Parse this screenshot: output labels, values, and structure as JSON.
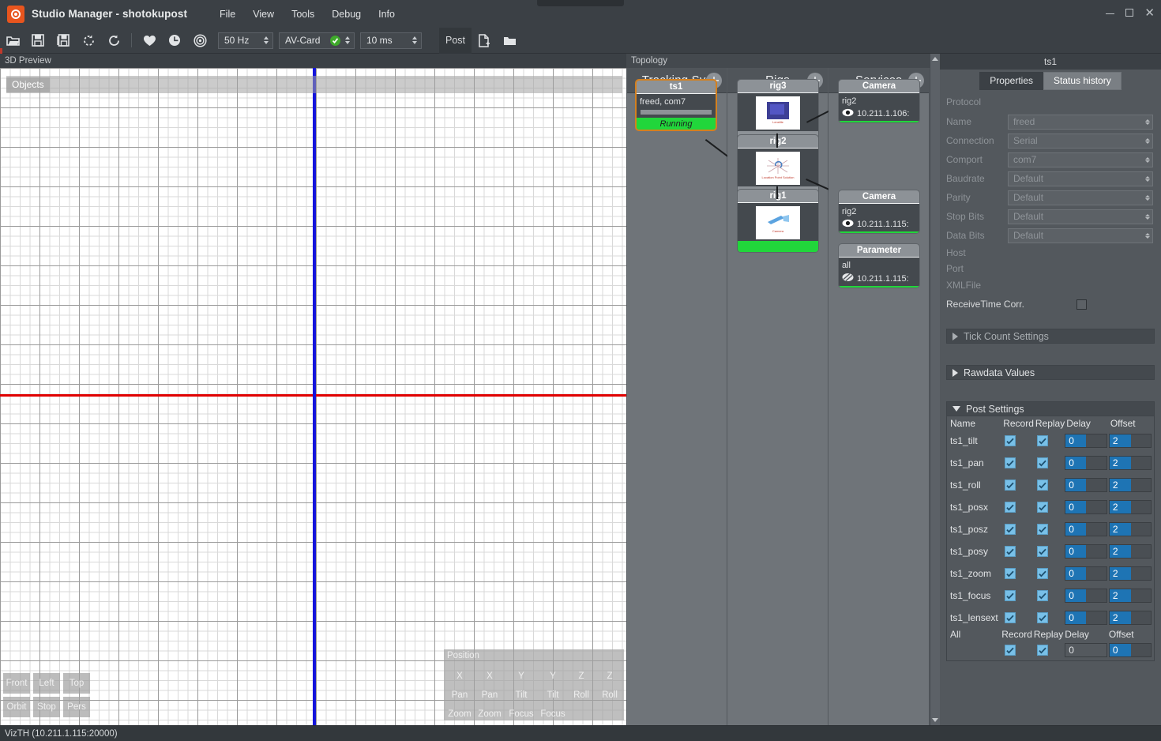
{
  "window": {
    "title": "Studio Manager - shotokupost",
    "logo_icon": "studio-manager-logo",
    "minimize_label": "minimize",
    "maximize_label": "maximize",
    "close_label": "✕"
  },
  "menubar": {
    "items": [
      "File",
      "View",
      "Tools",
      "Debug",
      "Info"
    ]
  },
  "toolbar": {
    "icons": [
      {
        "name": "open-folder-icon"
      },
      {
        "name": "save-icon"
      },
      {
        "name": "save-as-icon"
      },
      {
        "name": "reload-dashed-icon"
      },
      {
        "name": "refresh-icon"
      },
      {
        "name": "heart-icon"
      },
      {
        "name": "clock-icon"
      },
      {
        "name": "target-icon"
      }
    ],
    "framerate": {
      "value": "50 Hz"
    },
    "avcard": {
      "value": "AV-Card",
      "status_icon": "check-ok-icon",
      "status_color": "#3faa2b"
    },
    "latency": {
      "value": "10 ms"
    },
    "post_label": "Post",
    "post_new_icon": "new-document-icon",
    "post_open_icon": "open-folder-icon"
  },
  "preview": {
    "caption": "3D Preview",
    "objects_label": "Objects",
    "axis_h_color": "#e00000",
    "axis_v_color": "#1414dc",
    "view_buttons_top": [
      "Front",
      "Left",
      "Top"
    ],
    "view_buttons_bottom": [
      "Orbit",
      "Stop",
      "Pers"
    ],
    "position_overlay": {
      "title": "Position",
      "row1": [
        "X",
        "X",
        "Y",
        "Y",
        "Z",
        "Z"
      ],
      "row2": [
        "Pan",
        "Pan",
        "Tilt",
        "Tilt",
        "Roll",
        "Roll"
      ],
      "row3": [
        "Zoom",
        "Zoom",
        "Focus",
        "Focus",
        "",
        ""
      ]
    }
  },
  "topology": {
    "caption": "Topology",
    "columns": [
      {
        "title": "Tracking Sys",
        "add_icon": "plus-circle-icon"
      },
      {
        "title": "Rigs",
        "add_icon": "plus-circle-icon"
      },
      {
        "title": "Services",
        "add_icon": "plus-circle-icon"
      }
    ],
    "tracking_nodes": [
      {
        "title": "ts1",
        "detail": "freed,  com7",
        "status": "Running",
        "selected": true,
        "status_color": "#21d63b"
      }
    ],
    "rig_nodes": [
      {
        "title": "rig3",
        "thumb_caption": "Lensfile",
        "footer_green": false
      },
      {
        "title": "rig2",
        "thumb_caption": "Location Point Solution",
        "footer_green": false
      },
      {
        "title": "rig1",
        "thumb_caption": "Camera",
        "footer_green": true
      }
    ],
    "service_nodes": [
      {
        "title": "Camera",
        "source": "rig2",
        "icon": "eye-icon",
        "address": "10.211.1.106:"
      },
      {
        "title": "Camera",
        "source": "rig2",
        "icon": "eye-icon",
        "address": "10.211.1.115:"
      },
      {
        "title": "Parameter",
        "source": "all",
        "icon": "layers-icon",
        "address": "10.211.1.115:"
      }
    ]
  },
  "properties": {
    "header_title": "ts1",
    "tabs": [
      {
        "label": "Properties",
        "active": true
      },
      {
        "label": "Status history",
        "active": false
      }
    ],
    "section_title": "Protocol",
    "fields": [
      {
        "label": "Name",
        "value": "freed",
        "has_input": true,
        "spinner": true
      },
      {
        "label": "Connection",
        "value": "Serial",
        "has_input": true,
        "spinner": true
      },
      {
        "label": "Comport",
        "value": "com7",
        "has_input": true,
        "spinner": true
      },
      {
        "label": "Baudrate",
        "value": "Default",
        "has_input": true,
        "spinner": true
      },
      {
        "label": "Parity",
        "value": "Default",
        "has_input": true,
        "spinner": true
      },
      {
        "label": "Stop Bits",
        "value": "Default",
        "has_input": true,
        "spinner": true
      },
      {
        "label": "Data Bits",
        "value": "Default",
        "has_input": true,
        "spinner": true
      },
      {
        "label": "Host",
        "value": "",
        "has_input": false,
        "spinner": false
      },
      {
        "label": "Port",
        "value": "",
        "has_input": false,
        "spinner": false
      },
      {
        "label": "XMLFile",
        "value": "",
        "has_input": false,
        "spinner": false
      }
    ],
    "receive_time_corr": {
      "label": "ReceiveTime Corr.",
      "checked": false
    },
    "tick_count_settings": {
      "label": "Tick Count Settings",
      "expanded": false
    },
    "rawdata_values": {
      "label": "Rawdata Values",
      "expanded": false
    },
    "post_settings": {
      "label": "Post Settings",
      "expanded": true,
      "columns": [
        "Name",
        "Record",
        "Replay",
        "Delay",
        "Offset"
      ],
      "rows": [
        {
          "name": "ts1_tilt",
          "record": true,
          "replay": true,
          "delay": "0",
          "offset": "2"
        },
        {
          "name": "ts1_pan",
          "record": true,
          "replay": true,
          "delay": "0",
          "offset": "2"
        },
        {
          "name": "ts1_roll",
          "record": true,
          "replay": true,
          "delay": "0",
          "offset": "2"
        },
        {
          "name": "ts1_posx",
          "record": true,
          "replay": true,
          "delay": "0",
          "offset": "2"
        },
        {
          "name": "ts1_posz",
          "record": true,
          "replay": true,
          "delay": "0",
          "offset": "2"
        },
        {
          "name": "ts1_posy",
          "record": true,
          "replay": true,
          "delay": "0",
          "offset": "2"
        },
        {
          "name": "ts1_zoom",
          "record": true,
          "replay": true,
          "delay": "0",
          "offset": "2"
        },
        {
          "name": "ts1_focus",
          "record": true,
          "replay": true,
          "delay": "0",
          "offset": "2"
        },
        {
          "name": "ts1_lensext",
          "record": true,
          "replay": true,
          "delay": "0",
          "offset": "2"
        }
      ],
      "all_row": {
        "name": "All",
        "columns": [
          "Record",
          "Replay",
          "Delay",
          "Offset"
        ],
        "record": true,
        "replay": true,
        "delay": "0",
        "offset": "0"
      }
    }
  },
  "statusbar": {
    "text": "VizTH (10.211.1.115:20000)"
  }
}
